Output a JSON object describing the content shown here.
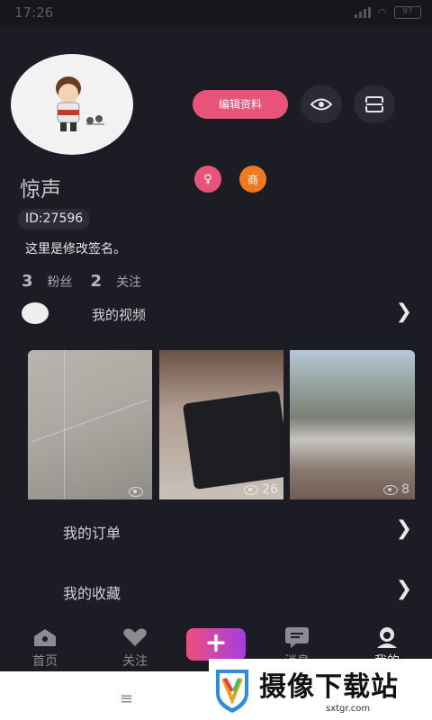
{
  "status_bar": {
    "time": "17:26",
    "battery": "97"
  },
  "profile": {
    "edit_button": "编辑资料",
    "name": "惊声",
    "id": "ID:27596",
    "signature": "这里是修改签名。",
    "badges": {
      "female": "♀",
      "shop": "商"
    },
    "fans_count": "3",
    "fans_label": "粉丝",
    "following_count": "2",
    "following_label": "关注"
  },
  "videos_section": {
    "title": "我的视频",
    "items": [
      {
        "views": ""
      },
      {
        "views": "26"
      },
      {
        "views": "8"
      }
    ]
  },
  "menu": {
    "orders": "我的订单",
    "favorites": "我的收藏"
  },
  "tabbar": {
    "home": "首页",
    "follow": "关注",
    "add": "+",
    "messages": "消息",
    "me": "我的"
  },
  "watermark": {
    "text": "摄像下载站",
    "url": "sxtgr.com"
  },
  "colors": {
    "accent": "#e8537a",
    "shop": "#ee7a1f",
    "background": "#1c1d24"
  }
}
